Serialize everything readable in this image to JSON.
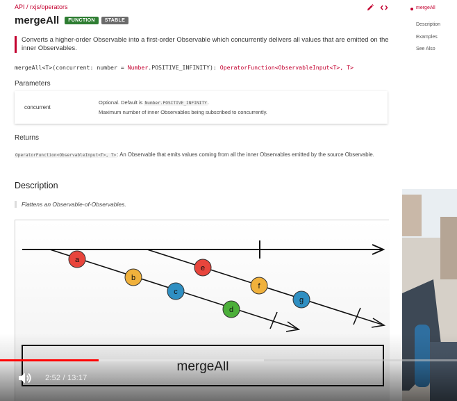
{
  "breadcrumb": "API / rxjs/operators",
  "title": "mergeAll",
  "badges": {
    "function": "FUNCTION",
    "stable": "STABLE"
  },
  "toolbar": {
    "edit_icon": "pencil-icon",
    "source_icon": "code-icon"
  },
  "summary": "Converts a higher-order Observable into a first-order Observable which concurrently delivers all values that are emitted on the inner Observables.",
  "signature": {
    "name": "mergeAll",
    "generic": "<T>",
    "params": "(concurrent: number = ",
    "default_type": "Number",
    "default_rest": ".POSITIVE_INFINITY): ",
    "return_type": "OperatorFunction",
    "return_rest": "<ObservableInput<T>, T>"
  },
  "parameters": {
    "heading": "Parameters",
    "rows": [
      {
        "name": "concurrent",
        "desc1_prefix": "Optional. Default is ",
        "desc1_code": "Number.POSITIVE_INFINITY",
        "desc1_suffix": ".",
        "desc2": "Maximum number of inner Observables being subscribed to concurrently."
      }
    ]
  },
  "returns": {
    "heading": "Returns",
    "code": "OperatorFunction<ObservableInput<T>, T>",
    "text": ": An Observable that emits values coming from all the inner Observables emitted by the source Observable."
  },
  "description": {
    "heading": "Description",
    "quote": "Flattens an Observable-of-Observables."
  },
  "diagram": {
    "marbles": [
      {
        "label": "a",
        "color": "#e8453c"
      },
      {
        "label": "b",
        "color": "#f0b13c"
      },
      {
        "label": "c",
        "color": "#2f8fc2"
      },
      {
        "label": "d",
        "color": "#4caf3a"
      },
      {
        "label": "e",
        "color": "#e8453c"
      },
      {
        "label": "f",
        "color": "#f0b13c"
      },
      {
        "label": "g",
        "color": "#2f8fc2"
      }
    ],
    "operator_label": "mergeAll"
  },
  "toc": {
    "items": [
      "mergeAll",
      "Description",
      "Examples",
      "See Also"
    ],
    "active": "mergeAll"
  },
  "player": {
    "current_time": "2:52",
    "duration": "13:17",
    "time_display": "2:52 / 13:17",
    "progress_fraction": 0.216,
    "buffered_fraction": 0.578,
    "volume_icon": "speaker-icon",
    "accent_color": "#ff0000"
  }
}
